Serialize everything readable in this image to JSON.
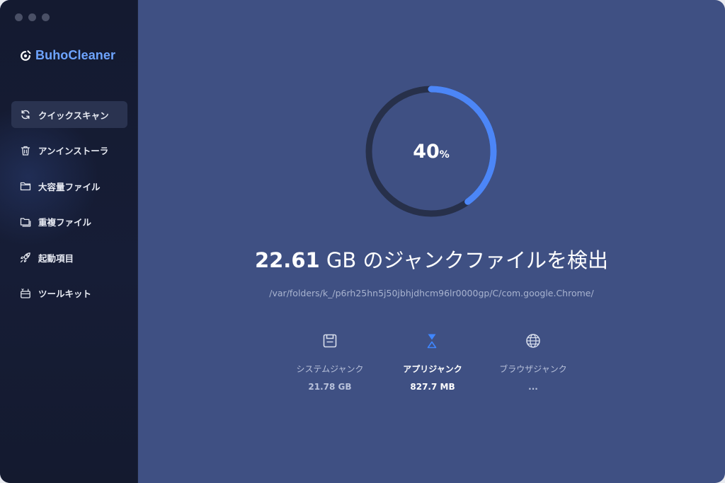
{
  "app": {
    "name": "BuhoCleaner",
    "brand_color": "#6ea4ff"
  },
  "window_controls": [
    "close",
    "minimize",
    "zoom"
  ],
  "sidebar": {
    "items": [
      {
        "label": "クイックスキャン",
        "icon": "refresh-icon",
        "active": true
      },
      {
        "label": "アンインストーラ",
        "icon": "trash-icon",
        "active": false
      },
      {
        "label": "大容量ファイル",
        "icon": "folder-icon",
        "active": false
      },
      {
        "label": "重複ファイル",
        "icon": "folders-icon",
        "active": false
      },
      {
        "label": "起動項目",
        "icon": "rocket-icon",
        "active": false
      },
      {
        "label": "ツールキット",
        "icon": "toolkit-icon",
        "active": false
      }
    ]
  },
  "scan": {
    "progress_percent": 40,
    "percent_value": "40",
    "percent_sign": "%",
    "found_size": "22.61",
    "found_text": " GB のジャンクファイルを検出",
    "current_path": "/var/folders/k_/p6rh25hn5j50jbhjdhcm96lr0000gp/C/com.google.Chrome/",
    "ring_color": "#4c86f7",
    "ring_track_color": "#27304a"
  },
  "categories": [
    {
      "label": "システムジャンク",
      "value": "21.78 GB",
      "icon": "floppy-disk-icon",
      "active": false
    },
    {
      "label": "アプリジャンク",
      "value": "827.7 MB",
      "icon": "hourglass-icon",
      "active": true
    },
    {
      "label": "ブラウザジャンク",
      "value": "...",
      "icon": "globe-icon",
      "active": false
    }
  ]
}
